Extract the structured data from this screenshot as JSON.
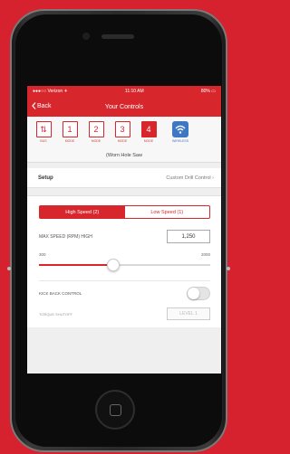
{
  "status": {
    "carrier": "●●●○○ Verizon ✈",
    "time": "11:10 AM",
    "battery": "80% ▭"
  },
  "nav": {
    "back_label": "Back",
    "title": "Your Controls"
  },
  "tools": [
    {
      "symbol": "⇅",
      "label": "BUS",
      "active": false
    },
    {
      "symbol": "1",
      "label": "MODE",
      "active": false
    },
    {
      "symbol": "2",
      "label": "MODE",
      "active": false
    },
    {
      "symbol": "3",
      "label": "MODE",
      "active": false
    },
    {
      "symbol": "4",
      "label": "MODE",
      "active": true
    }
  ],
  "wifi": {
    "label": "WIRELESS"
  },
  "subtitle": "(Worn Hole Saw",
  "setup": {
    "label": "Setup",
    "value": "Custom Drill Control"
  },
  "segments": [
    {
      "label": "High Speed (2)",
      "active": true
    },
    {
      "label": "Low Speed (1)",
      "active": false
    }
  ],
  "speed": {
    "label": "MAX SPEED (RPM) HIGH",
    "value": "1,250"
  },
  "range": {
    "min": "300",
    "max": "2000"
  },
  "slider": {
    "fraction": 0.43
  },
  "toggle": {
    "label": "KICK BACK CONTROL",
    "on": false
  },
  "torque": {
    "label": "TORQUE SHUTOFF",
    "button": "LEVEL 1"
  },
  "colors": {
    "accent": "#d7262c",
    "wifi": "#3e78c4",
    "background": "#d5222e"
  }
}
